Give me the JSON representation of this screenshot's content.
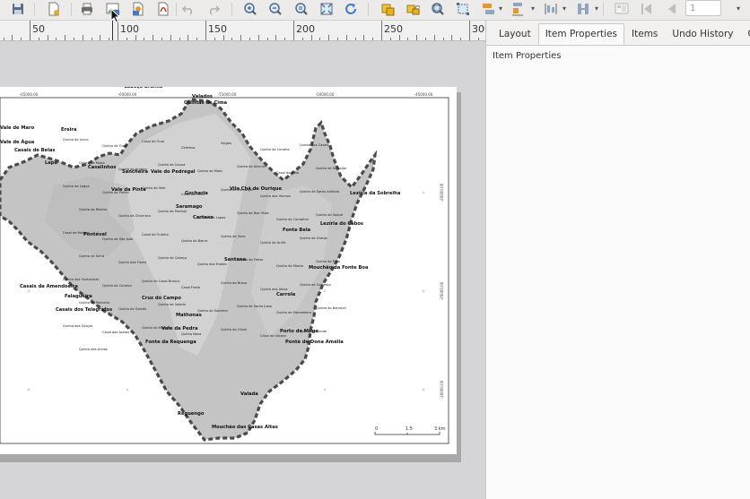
{
  "toolbar": {
    "icons": [
      "save-icon",
      "new-layout-icon",
      "print-icon",
      "export-image-icon",
      "export-svg-icon",
      "export-pdf-icon",
      "undo-icon",
      "redo-icon",
      "zoom-in-icon",
      "zoom-out-icon",
      "zoom-actual-icon",
      "zoom-full-icon",
      "refresh-icon",
      "lock-icon",
      "unlock-icon",
      "select-icon",
      "resize-icon",
      "align-icon",
      "distribute-icon",
      "raise-icon",
      "atlas-settings-icon",
      "first-feature-icon",
      "previous-feature-icon"
    ],
    "page_value": "1"
  },
  "ruler": {
    "labels": [
      "50",
      "100",
      "150",
      "200",
      "250",
      "300"
    ]
  },
  "panel": {
    "tabs": [
      "Layout",
      "Item Properties",
      "Items",
      "Undo History",
      "Guides"
    ],
    "active_tab": "Item Properties",
    "title": "Item Properties"
  },
  "map": {
    "top_coords": [
      "-65000.00",
      "-60000.00",
      "-55000.00",
      "-50000.00",
      "-45000.00"
    ],
    "right_coords": [
      "-20000.00",
      "-25000.00",
      "-30000.00"
    ],
    "scalebar": {
      "labels": [
        "0",
        "1.5",
        "3 km"
      ]
    },
    "places_bold": [
      "Cabeço Branco",
      "Valados",
      "Quintas de Cima",
      "Ereira",
      "Vale de Maro",
      "Vale de Água",
      "Casais de Belas",
      "Lapa",
      "Vale da Pinta",
      "Cartaxo",
      "Pontével",
      "Vila Chã de Ourique",
      "Fonte Bela",
      "Lezíria do Cabos",
      "Lezíria da Sobreiha",
      "Mouchão da Fonte Boa",
      "Cruz do Campo",
      "Casais da Amendoeira",
      "Falagueira",
      "Casais dos Telegrafos",
      "Vale da Pedra",
      "Fonte da Requenga",
      "Carrola",
      "Porto de Muge",
      "Ponte de Dona Amélia",
      "Valada",
      "Reguengo",
      "Mouchão das Casas Altas",
      "Santana",
      "Mathonas",
      "Gocharia",
      "Saramago",
      "Vale do Pedregal",
      "Sancheira",
      "Casalinhos"
    ],
    "places_small": [
      "Quinta do Junco",
      "Quinta de Ouro",
      "Casal do Ouro",
      "Celeirios",
      "Viegas",
      "Quinta de Coralhe",
      "Quinta dos Casais",
      "Quinta da Moita",
      "Quinta do Arneiro",
      "Quinta da Gouxa",
      "Quinta do Mato",
      "Quinta do Alecrim",
      "Casal do Gato",
      "Quinta do Salvador",
      "Quinta da Lagoa",
      "Quinta do Pinhal",
      "Quinta do Vale",
      "Casal da Fonte",
      "Quinta do Zambujal",
      "Quinta dos Varinos",
      "Quinta de Santo António",
      "Quinta da Ribeira",
      "Quinta da Charneca",
      "Quinta do Pombal",
      "Quinta das Lapas",
      "Quinta da Boa Vista",
      "Quinta do Carvalhal",
      "Quinta do Sobral",
      "Casal do Moinho",
      "Quinta de São João",
      "Casal do Outeiro",
      "Quinta do Bairro",
      "Quinta da Torre",
      "Quinta do Arrife",
      "Quinta da Granja",
      "Quinta da Serra",
      "Quinta das Flores",
      "Quinta da Cabeça",
      "Quinta dos Frades",
      "Quinta do Freixo",
      "Quinta da Mouta",
      "Quinta do Paço",
      "Quinta das Fontainhas",
      "Quinta da Caneira",
      "Quinta do Casal Branco",
      "Casal Frade",
      "Quinta do Bravo",
      "Quinta dos Alhos",
      "Quinta do Colombo",
      "Quinta da Palmeira",
      "Quinta do Galvão",
      "Quinta de Valada",
      "Quinta do Sobreiro",
      "Quinta de Santa Justa",
      "Quinta do Marmeleiro",
      "Quinta do Barrocal",
      "Quinta das Garças",
      "Casal das Aveias",
      "Quinta do Mourão",
      "Quinta Nova",
      "Quinta do Olival",
      "Casal da Várzea",
      "Quinta do Conde",
      "Quinta das Areias"
    ]
  }
}
